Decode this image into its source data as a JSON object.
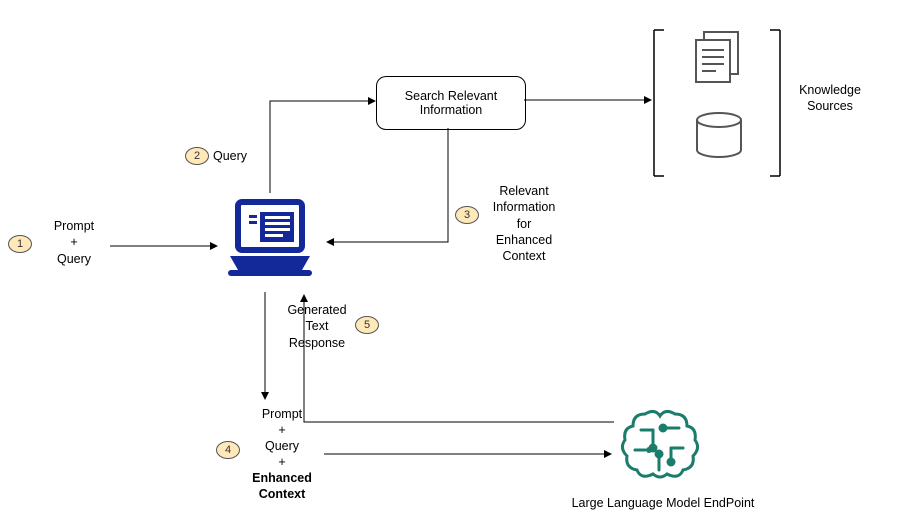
{
  "steps": {
    "s1": {
      "num": "1",
      "label": "Prompt\n+\nQuery"
    },
    "s2": {
      "num": "2",
      "label": "Query"
    },
    "s3": {
      "num": "3",
      "label": "Relevant\nInformation\nfor\nEnhanced\nContext"
    },
    "s4": {
      "num": "4",
      "label_top": "Prompt\n+\nQuery\n+",
      "label_bold": "Enhanced\nContext"
    },
    "s5": {
      "num": "5",
      "label": "Generated\nText\nResponse"
    }
  },
  "box": {
    "search": "Search Relevant\nInformation"
  },
  "labels": {
    "knowledge": "Knowledge\nSources",
    "llm": "Large Language Model EndPoint"
  }
}
